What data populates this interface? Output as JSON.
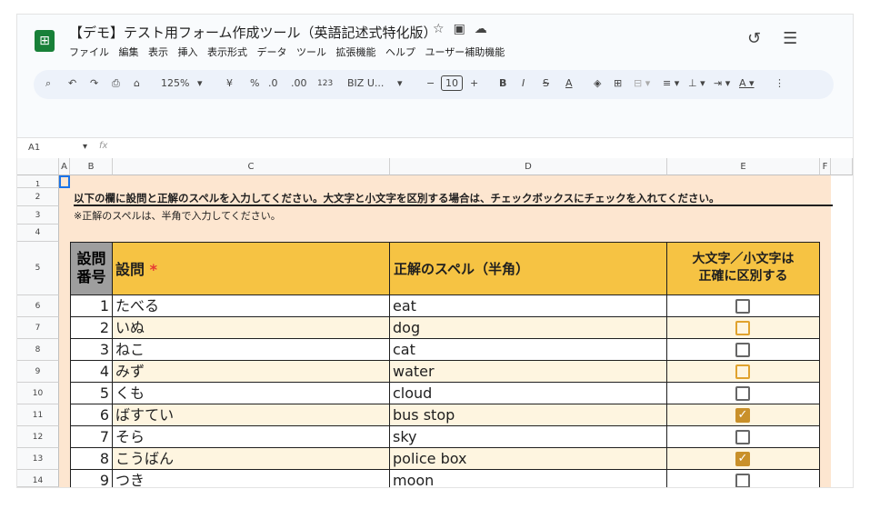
{
  "doc": {
    "title": "【デモ】テスト用フォーム作成ツール（英語記述式特化版）",
    "logo_icon": "sheets-logo-icon",
    "menus": [
      "ファイル",
      "編集",
      "表示",
      "挿入",
      "表示形式",
      "データ",
      "ツール",
      "拡張機能",
      "ヘルプ",
      "ユーザー補助機能"
    ]
  },
  "toolbar": {
    "zoom": "125%",
    "currency": "¥",
    "percent": "%",
    "dec_decrease": ".0",
    "dec_increase": ".00",
    "format_123": "123",
    "font": "BIZ U...",
    "minus": "−",
    "font_size": "10",
    "plus": "+",
    "bold": "B",
    "italic": "I",
    "strike": "S",
    "text_color": "A"
  },
  "formula_bar": {
    "cell_ref": "A1",
    "fx": "fx",
    "value": ""
  },
  "columns": [
    "A",
    "B",
    "C",
    "D",
    "E",
    "F"
  ],
  "rows": [
    "1",
    "2",
    "3",
    "4",
    "5",
    "6",
    "7",
    "8",
    "9",
    "10",
    "11",
    "12",
    "13",
    "14"
  ],
  "instructions": {
    "line1": "以下の欄に設問と正解のスペルを入力してください。大文字と小文字を区別する場合は、チェックボックスにチェックを入れてください。",
    "line2": "※正解のスペルは、半角で入力してください。"
  },
  "table": {
    "headers": {
      "num": "設問\n番号",
      "question": "設問",
      "required_mark": "*",
      "answer": "正解のスペル（半角）",
      "case": "大文字／小文字は\n正確に区別する"
    },
    "rows": [
      {
        "num": "1",
        "question": "たべる",
        "answer": "eat",
        "checked": false
      },
      {
        "num": "2",
        "question": "いぬ",
        "answer": "dog",
        "checked": false
      },
      {
        "num": "3",
        "question": "ねこ",
        "answer": "cat",
        "checked": false
      },
      {
        "num": "4",
        "question": "みず",
        "answer": "water",
        "checked": false
      },
      {
        "num": "5",
        "question": "くも",
        "answer": "cloud",
        "checked": false
      },
      {
        "num": "6",
        "question": "ばすてい",
        "answer": "bus stop",
        "checked": true
      },
      {
        "num": "7",
        "question": "そら",
        "answer": "sky",
        "checked": false
      },
      {
        "num": "8",
        "question": "こうばん",
        "answer": "police box",
        "checked": true
      },
      {
        "num": "9",
        "question": "つき",
        "answer": "moon",
        "checked": false
      }
    ]
  }
}
